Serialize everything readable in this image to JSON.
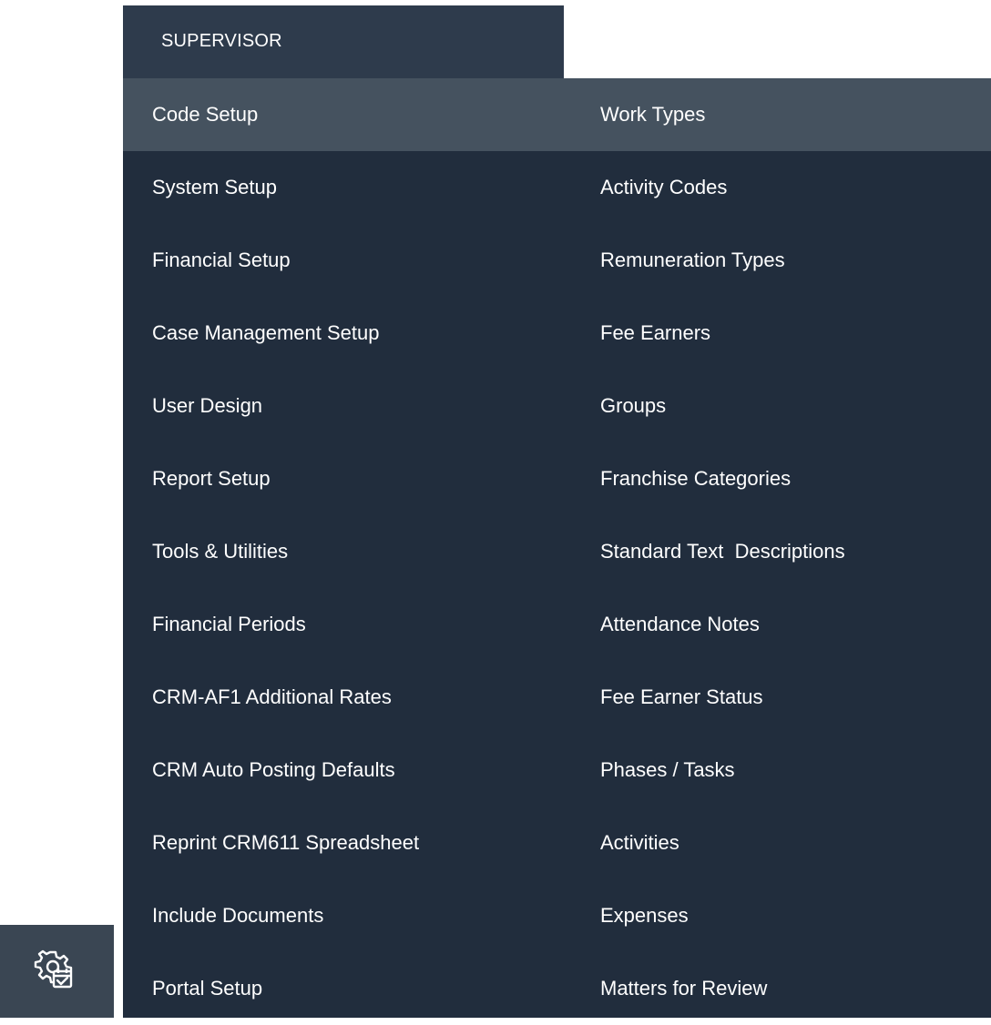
{
  "header": {
    "title": "SUPERVISOR"
  },
  "menu": {
    "left_items": [
      "Code Setup",
      "System Setup",
      "Financial Setup",
      "Case Management Setup",
      "User Design",
      "Report Setup",
      "Tools & Utilities",
      "Financial Periods",
      "CRM-AF1 Additional Rates",
      "CRM Auto Posting Defaults",
      "Reprint CRM611 Spreadsheet",
      "Include Documents",
      "Portal Setup"
    ],
    "right_items": [
      "Work Types",
      "Activity Codes",
      "Remuneration Types",
      "Fee Earners",
      "Groups",
      "Franchise Categories",
      "Standard Text  Descriptions",
      "Attendance Notes",
      "Fee Earner Status",
      "Phases / Tasks",
      "Activities",
      "Expenses",
      "Matters for Review"
    ],
    "active_item": "Code Setup"
  },
  "sidebar": {
    "icon": "settings-gear-calendar-icon"
  },
  "colors": {
    "header_bg": "#2e3b4c",
    "menu_bg": "#212d3d",
    "active_row_bg": "#45525f",
    "sidebar_bg": "#3a4653",
    "text": "#ffffff"
  }
}
